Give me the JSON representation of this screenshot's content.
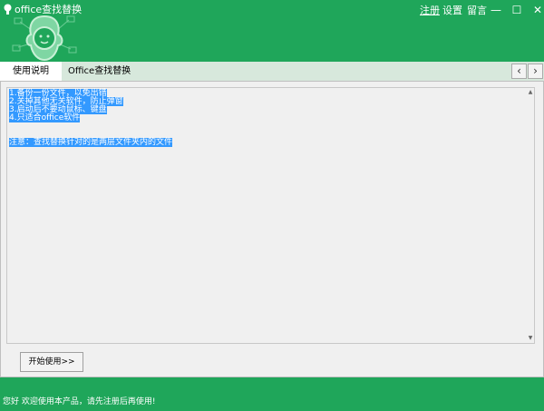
{
  "window": {
    "title": "office查找替换",
    "menu": {
      "register": "注册",
      "settings": "设置",
      "message": "留言"
    },
    "controls": {
      "minimize": "—",
      "maximize": "☐",
      "close": "✕"
    }
  },
  "tabs": {
    "items": [
      {
        "label": "使用说明",
        "active": true
      },
      {
        "label": "Office查找替换",
        "active": false
      }
    ],
    "prev": "‹",
    "next": "›"
  },
  "instructions": {
    "lines": [
      "1.备份一份文件，以免出错",
      "2.关掉其他无关软件，防止弹窗",
      "3.启动后不要动鼠标、键盘",
      "4.只适合office软件"
    ],
    "note": "注意：查找替换针对的是两层文件夹内的文件"
  },
  "scrollbar": {
    "up": "▲",
    "down": "▼"
  },
  "start_button": "开始使用>>",
  "status": "您好 欢迎使用本产品，请先注册后再使用!",
  "colors": {
    "brand_green": "#1fa65a",
    "tab_bar": "#d7e8dc",
    "selection": "#3399ff"
  },
  "icons": {
    "app": "app-logo-icon",
    "logo": "mascot-logo-icon"
  }
}
